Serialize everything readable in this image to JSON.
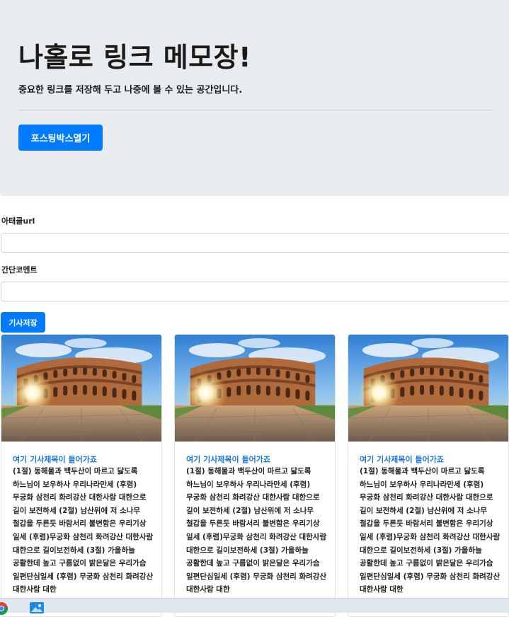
{
  "jumbotron": {
    "title": "나홀로 링크 메모장!",
    "lead": "중요한 링크를 저장해 두고 나중에 볼 수 있는 공간입니다.",
    "open_button": "포스팅박스열기"
  },
  "form": {
    "url_label": "아태클url",
    "url_value": "",
    "comment_label": "간단코멘트",
    "comment_value": "",
    "save_button": "기사저장"
  },
  "cards": [
    {
      "title": "여기 기사제목이 들어가죠",
      "text": "(1절) 동해물과 백두산이 마르고 닳도록 하느님이 보우하사 우리나라만세 (후렴) 무궁화 삼천리 화려강산 대한사람 대한으로 길이 보전하세 (2절) 남산위에 저 소나무 철갑을 두른듯 바람서리 불변함은 우리기상 일세 (후렴)무궁화 삼천리 화려강산 대한사람 대한으로 길이보전하세 (3절) 가을하늘 공활한데 높고 구름없이 밝은달은 우리가슴 일편단심일세 (후렴) 무궁화 삼천리 화려강산 대한사람 대한"
    },
    {
      "title": "여기 기사제목이 들어가죠",
      "text": "(1절) 동해물과 백두산이 마르고 닳도록 하느님이 보우하사 우리나라만세 (후렴) 무궁화 삼천리 화려강산 대한사람 대한으로 길이 보전하세 (2절) 남산위에 저 소나무 철갑을 두른듯 바람서리 불변함은 우리기상 일세 (후렴)무궁화 삼천리 화려강산 대한사람 대한으로 길이보전하세 (3절) 가을하늘 공활한데 높고 구름없이 밝은달은 우리가슴 일편단심일세 (후렴) 무궁화 삼천리 화려강산 대한사람 대한"
    },
    {
      "title": "여기 기사제목이 들어가죠",
      "text": "(1절) 동해물과 백두산이 마르고 닳도록 하느님이 보우하사 우리나라만세 (후렴) 무궁화 삼천리 화려강산 대한사람 대한으로 길이 보전하세 (2절) 남산위에 저 소나무 철갑을 두른듯 바람서리 불변함은 우리기상 일세 (후렴)무궁화 삼천리 화려강산 대한사람 대한으로 길이보전하세 (3절) 가을하늘 공활한데 높고 구름없이 밝은달은 우리가슴 일편단심일세 (후렴) 무궁화 삼천리 화려강산 대한사람 대한"
    }
  ],
  "colors": {
    "primary": "#007bff",
    "jumbotron_bg": "#e9ecef",
    "card_title": "#1a73d8"
  },
  "icons": {
    "card_image": "colosseum-photo",
    "taskbar": [
      "chrome-icon",
      "photos-icon"
    ]
  }
}
